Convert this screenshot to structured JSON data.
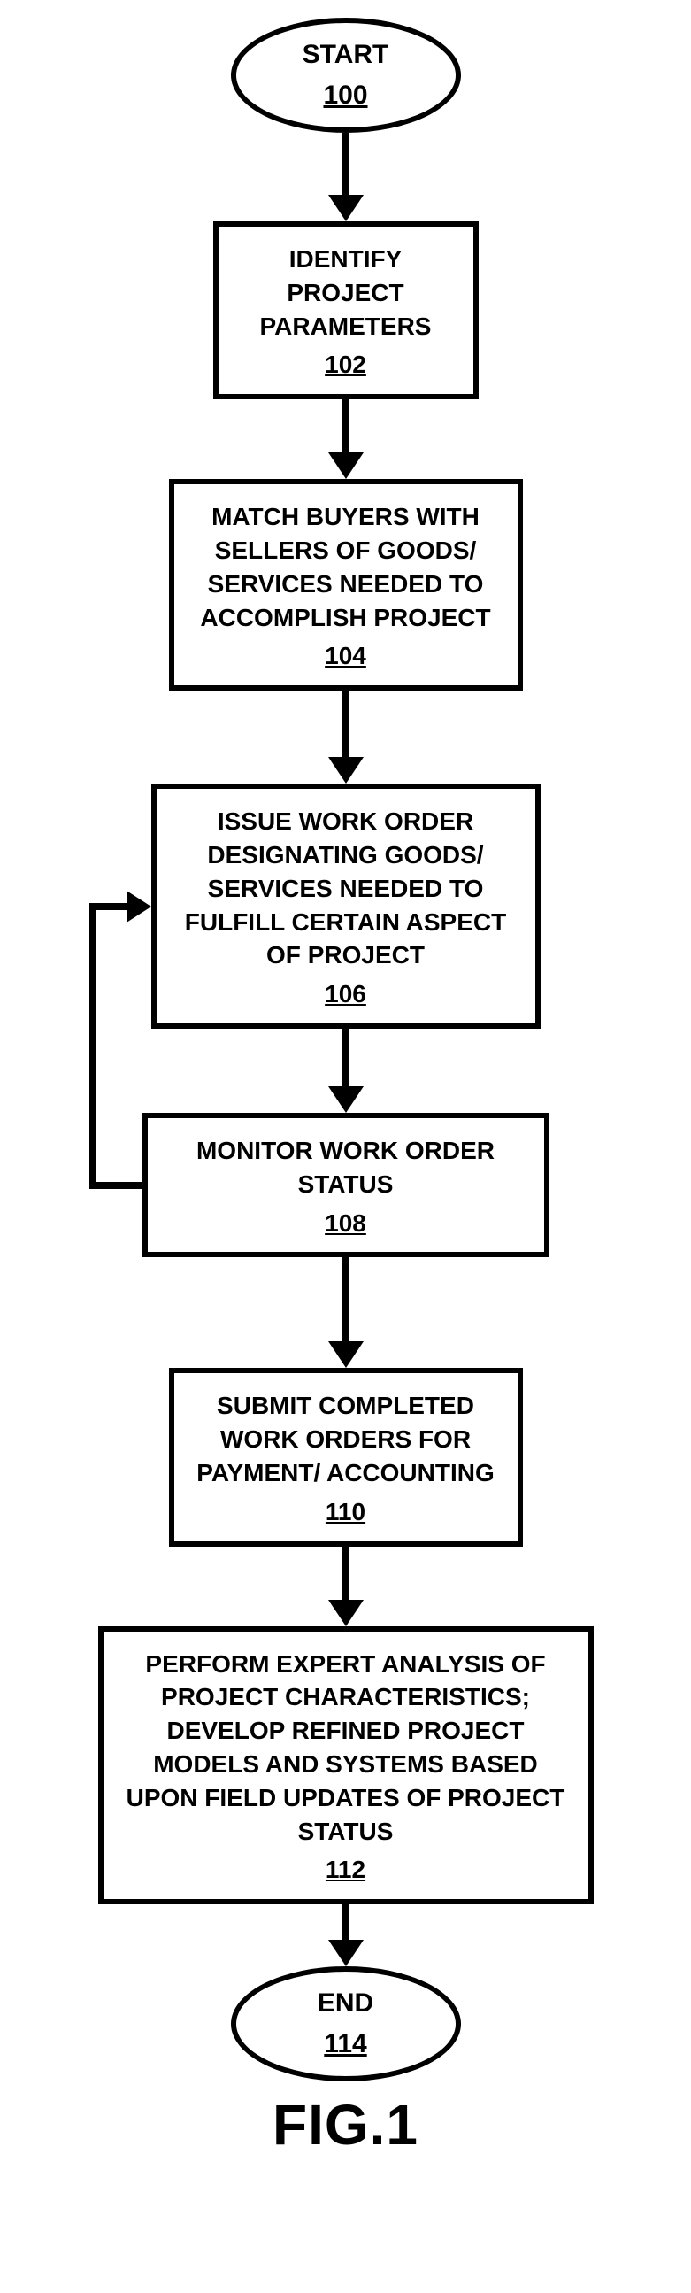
{
  "nodes": {
    "start": {
      "label": "START",
      "ref": "100"
    },
    "n102": {
      "label": "IDENTIFY PROJECT PARAMETERS",
      "ref": "102"
    },
    "n104": {
      "label": "MATCH BUYERS WITH SELLERS OF GOODS/ SERVICES NEEDED TO ACCOMPLISH PROJECT",
      "ref": "104"
    },
    "n106": {
      "label": "ISSUE WORK ORDER DESIGNATING GOODS/ SERVICES NEEDED TO FULFILL CERTAIN ASPECT OF PROJECT",
      "ref": "106"
    },
    "n108": {
      "label": "MONITOR WORK ORDER STATUS",
      "ref": "108"
    },
    "n110": {
      "label": "SUBMIT COMPLETED WORK ORDERS FOR PAYMENT/ ACCOUNTING",
      "ref": "110"
    },
    "n112": {
      "label": "PERFORM EXPERT ANALYSIS OF PROJECT CHARACTERISTICS; DEVELOP REFINED PROJECT MODELS AND SYSTEMS BASED UPON FIELD UPDATES OF PROJECT STATUS",
      "ref": "112"
    },
    "end": {
      "label": "END",
      "ref": "114"
    }
  },
  "figure_label": "FIG.1"
}
